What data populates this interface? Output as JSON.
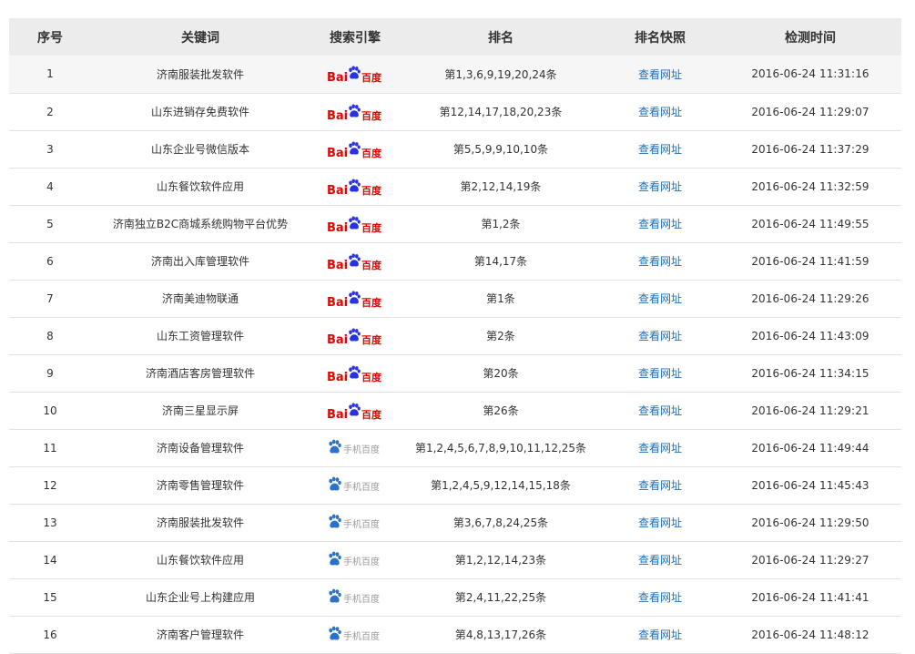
{
  "table": {
    "headers": [
      "序号",
      "关键词",
      "搜索引擎",
      "排名",
      "排名快照",
      "检测时间"
    ],
    "rows": [
      {
        "index": "1",
        "keyword": "济南服装批发软件",
        "engine": "baidu",
        "rank": "第1,3,6,9,19,20,24条",
        "snapshot": "查看网址",
        "time": "2016-06-24 11:31:16"
      },
      {
        "index": "2",
        "keyword": "山东进销存免费软件",
        "engine": "baidu",
        "rank": "第12,14,17,18,20,23条",
        "snapshot": "查看网址",
        "time": "2016-06-24 11:29:07"
      },
      {
        "index": "3",
        "keyword": "山东企业号微信版本",
        "engine": "baidu",
        "rank": "第5,5,9,9,10,10条",
        "snapshot": "查看网址",
        "time": "2016-06-24 11:37:29"
      },
      {
        "index": "4",
        "keyword": "山东餐饮软件应用",
        "engine": "baidu",
        "rank": "第2,12,14,19条",
        "snapshot": "查看网址",
        "time": "2016-06-24 11:32:59"
      },
      {
        "index": "5",
        "keyword": "济南独立B2C商城系统购物平台优势",
        "engine": "baidu",
        "rank": "第1,2条",
        "snapshot": "查看网址",
        "time": "2016-06-24 11:49:55"
      },
      {
        "index": "6",
        "keyword": "济南出入库管理软件",
        "engine": "baidu",
        "rank": "第14,17条",
        "snapshot": "查看网址",
        "time": "2016-06-24 11:41:59"
      },
      {
        "index": "7",
        "keyword": "济南美迪物联通",
        "engine": "baidu",
        "rank": "第1条",
        "snapshot": "查看网址",
        "time": "2016-06-24 11:29:26"
      },
      {
        "index": "8",
        "keyword": "山东工资管理软件",
        "engine": "baidu",
        "rank": "第2条",
        "snapshot": "查看网址",
        "time": "2016-06-24 11:43:09"
      },
      {
        "index": "9",
        "keyword": "济南酒店客房管理软件",
        "engine": "baidu",
        "rank": "第20条",
        "snapshot": "查看网址",
        "time": "2016-06-24 11:34:15"
      },
      {
        "index": "10",
        "keyword": "济南三星显示屏",
        "engine": "baidu",
        "rank": "第26条",
        "snapshot": "查看网址",
        "time": "2016-06-24 11:29:21"
      },
      {
        "index": "11",
        "keyword": "济南设备管理软件",
        "engine": "mobile-baidu",
        "rank": "第1,2,4,5,6,7,8,9,10,11,12,25条",
        "snapshot": "查看网址",
        "time": "2016-06-24 11:49:44"
      },
      {
        "index": "12",
        "keyword": "济南零售管理软件",
        "engine": "mobile-baidu",
        "rank": "第1,2,4,5,9,12,14,15,18条",
        "snapshot": "查看网址",
        "time": "2016-06-24 11:45:43"
      },
      {
        "index": "13",
        "keyword": "济南服装批发软件",
        "engine": "mobile-baidu",
        "rank": "第3,6,7,8,24,25条",
        "snapshot": "查看网址",
        "time": "2016-06-24 11:29:50"
      },
      {
        "index": "14",
        "keyword": "山东餐饮软件应用",
        "engine": "mobile-baidu",
        "rank": "第1,2,12,14,23条",
        "snapshot": "查看网址",
        "time": "2016-06-24 11:29:27"
      },
      {
        "index": "15",
        "keyword": "山东企业号上构建应用",
        "engine": "mobile-baidu",
        "rank": "第2,4,11,22,25条",
        "snapshot": "查看网址",
        "time": "2016-06-24 11:41:41"
      },
      {
        "index": "16",
        "keyword": "济南客户管理软件",
        "engine": "mobile-baidu",
        "rank": "第4,8,13,17,26条",
        "snapshot": "查看网址",
        "time": "2016-06-24 11:48:12"
      }
    ]
  },
  "logos": {
    "baidu": {
      "text_left": "Bai",
      "text_right": "百度",
      "color": "#e10602",
      "paw_color": "#2932e1"
    },
    "mobile-baidu": {
      "text": "手机百度",
      "color": "#9a9a9a",
      "paw_color": "#2b73c9"
    }
  },
  "colors": {
    "header_bg": "#ececec",
    "first_row_bg": "#f6f6f6",
    "link": "#1e6fb8",
    "row_border": "#e2e2e2"
  }
}
